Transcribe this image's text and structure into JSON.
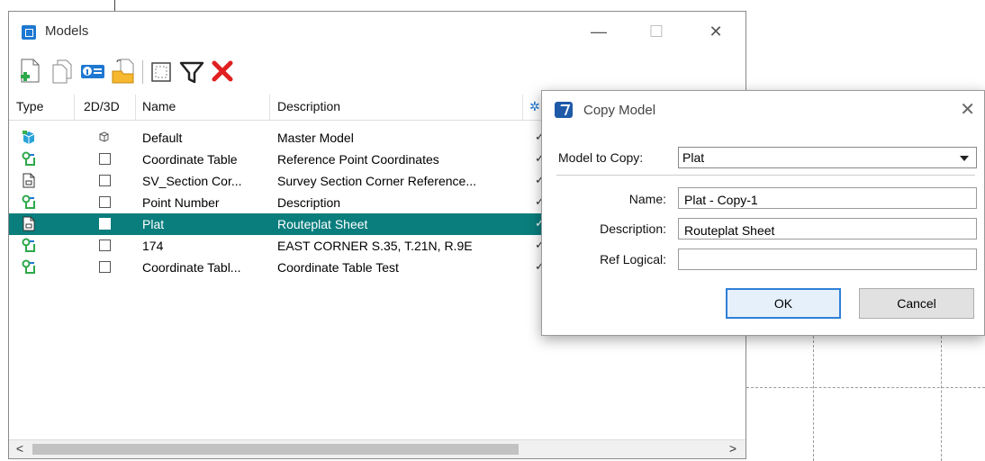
{
  "models_window": {
    "title": "Models",
    "controls": {
      "minimize": "—",
      "maximize": "☐",
      "close": "✕"
    },
    "toolbar_icons": [
      "new-model-icon",
      "copy-model-icon",
      "properties-icon",
      "import-icon",
      "selection-icon",
      "filter-icon",
      "delete-icon"
    ],
    "columns": {
      "type": "Type",
      "dim": "2D/3D",
      "name": "Name",
      "description": "Description"
    },
    "rows": [
      {
        "type_icon": "design-model-icon",
        "dim": "3d",
        "name": "Default",
        "description": "Master Model",
        "selected": false
      },
      {
        "type_icon": "drawing-model-icon",
        "dim": "2d",
        "name": "Coordinate Table",
        "description": "Reference Point Coordinates",
        "selected": false
      },
      {
        "type_icon": "sheet-model-icon",
        "dim": "2d",
        "name": "SV_Section Cor...",
        "description": "Survey Section Corner Reference...",
        "selected": false
      },
      {
        "type_icon": "drawing-model-icon",
        "dim": "2d",
        "name": "Point Number",
        "description": "Description",
        "selected": false
      },
      {
        "type_icon": "sheet-model-icon",
        "dim": "2d",
        "name": "Plat",
        "description": "Routeplat Sheet",
        "selected": true
      },
      {
        "type_icon": "drawing-model-icon",
        "dim": "2d",
        "name": "174",
        "description": "EAST CORNER S.35, T.21N, R.9E",
        "selected": false
      },
      {
        "type_icon": "drawing-model-icon",
        "dim": "2d",
        "name": "Coordinate Tabl...",
        "description": "Coordinate Table Test",
        "selected": false
      }
    ],
    "scroll_left": "<",
    "scroll_right": ">"
  },
  "copy_dialog": {
    "title": "Copy Model",
    "close": "✕",
    "model_to_copy_label": "Model to Copy:",
    "model_to_copy_value": "Plat",
    "name_label": "Name:",
    "name_value": "Plat - Copy-1",
    "description_label": "Description:",
    "description_value": "Routeplat Sheet",
    "ref_logical_label": "Ref Logical:",
    "ref_logical_value": "",
    "ok_label": "OK",
    "cancel_label": "Cancel"
  },
  "colors": {
    "selection": "#0a7d7d",
    "accent_blue": "#1e78d2",
    "delete_red": "#e02020",
    "ok_border": "#2f7fd7"
  }
}
